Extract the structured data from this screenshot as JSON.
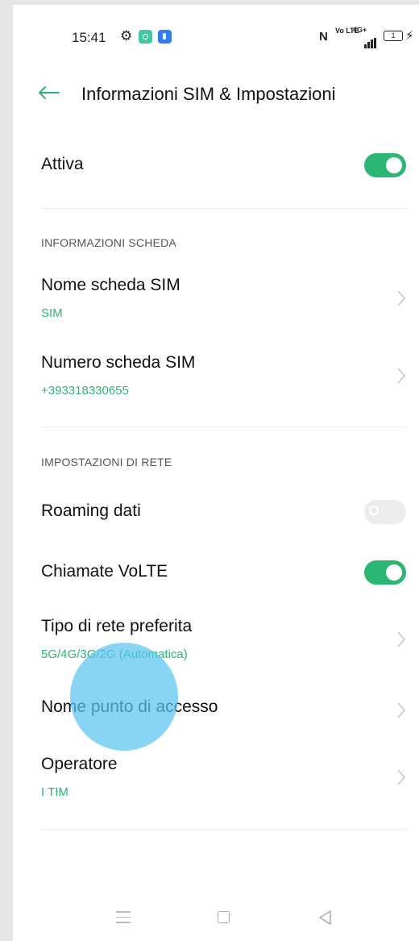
{
  "status_bar": {
    "time": "15:41",
    "battery_level": "1",
    "network": "4G+",
    "volte_label": "Vo LTE",
    "icons": [
      "gear-icon",
      "app-icon",
      "shield-icon",
      "nfc-icon",
      "volte-icon",
      "signal-icon",
      "battery-icon",
      "charging-icon"
    ]
  },
  "header": {
    "title": "Informazioni SIM & Impostazioni"
  },
  "attiva": {
    "label": "Attiva",
    "enabled": true
  },
  "card_info": {
    "section_label": "INFORMAZIONI SCHEDA",
    "items": [
      {
        "title": "Nome scheda SIM",
        "value": "SIM"
      },
      {
        "title": "Numero scheda SIM",
        "value": "+393318330655"
      }
    ]
  },
  "network_settings": {
    "section_label": "IMPOSTAZIONI DI RETE",
    "roaming": {
      "label": "Roaming dati",
      "enabled": false
    },
    "volte": {
      "label": "Chiamate VoLTE",
      "enabled": true
    },
    "items": [
      {
        "title": "Tipo di rete preferita",
        "value": "5G/4G/3G/2G (Automatica)"
      },
      {
        "title": "Nome punto di accesso"
      },
      {
        "title": "Operatore",
        "value": "I TIM"
      }
    ]
  },
  "colors": {
    "accent": "#2bb673",
    "touch_indicator": "#5ac3f0"
  }
}
